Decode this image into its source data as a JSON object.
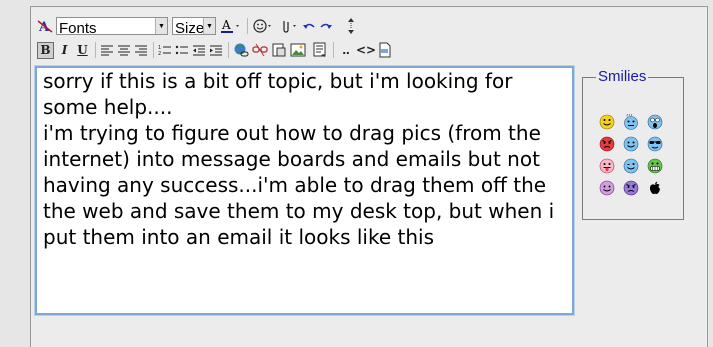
{
  "toolbar": {
    "font_select_value": "Fonts",
    "size_select_value": "Size",
    "font_color_label": "A",
    "bold_label": "B",
    "italic_label": "I",
    "underline_label": "U",
    "source_label": "<>",
    "reveal_label": "‥"
  },
  "editor": {
    "paragraphs": [
      "sorry if this is a bit off topic, but i'm looking for some help....",
      "",
      "i'm trying to figure out how to drag pics (from the internet) into message boards and emails but not having any success...i'm able to drag them off the the web and save them to my desk top, but when i put them into an email it looks like this"
    ]
  },
  "smilies": {
    "title": "Smilies",
    "icons": [
      "smile",
      "confused",
      "shocked",
      "mad",
      "cool",
      "sunglasses",
      "tongue",
      "wink",
      "grin",
      "blush",
      "purple-mad",
      "apple"
    ]
  },
  "colors": {
    "editor_border": "#7ea7d8",
    "smilies_title": "#1a1aa0",
    "smiley_yellow": "#f5d21e",
    "smiley_blue": "#7fc3f0",
    "smiley_red": "#e53b3b",
    "smiley_green": "#5fc94a",
    "smiley_purple": "#c58ee0"
  }
}
